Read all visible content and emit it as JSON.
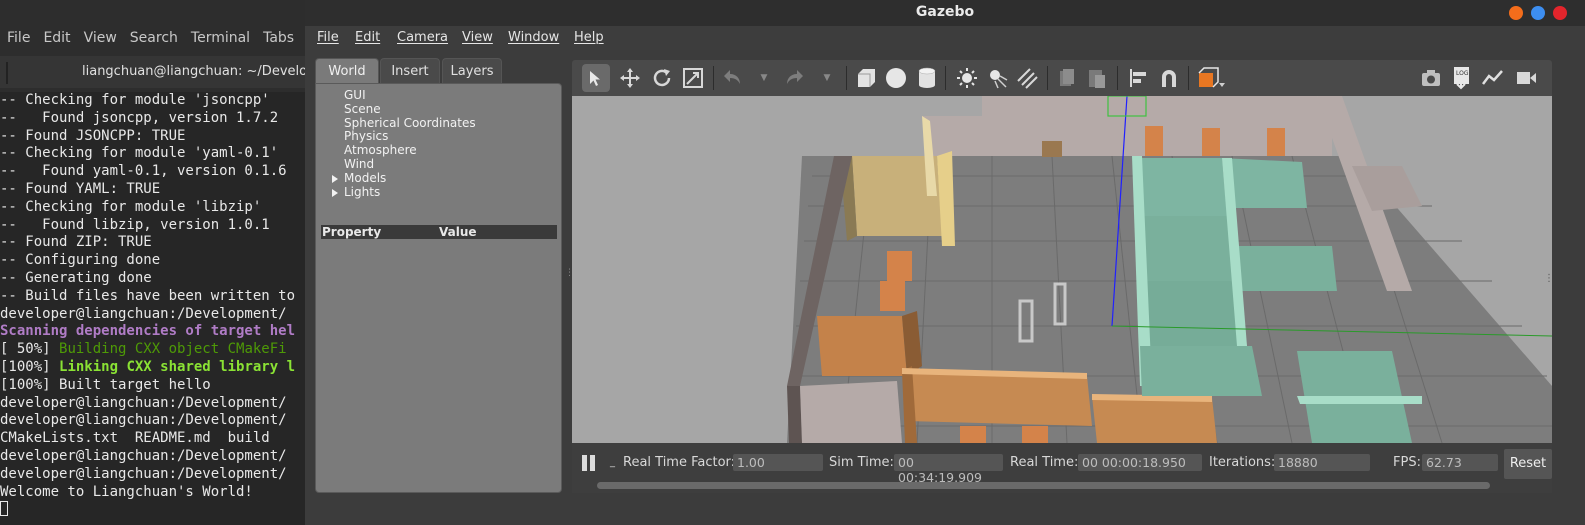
{
  "terminal": {
    "menu": [
      "File",
      "Edit",
      "View",
      "Search",
      "Terminal",
      "Tabs"
    ],
    "title": "liangchuan@liangchuan: ~/Develop",
    "lines": [
      {
        "text": "-- Checking for module 'jsoncpp'",
        "style": ""
      },
      {
        "text": "--   Found jsoncpp, version 1.7.2",
        "style": ""
      },
      {
        "text": "-- Found JSONCPP: TRUE",
        "style": ""
      },
      {
        "text": "-- Checking for module 'yaml-0.1'",
        "style": ""
      },
      {
        "text": "--   Found yaml-0.1, version 0.1.6",
        "style": ""
      },
      {
        "text": "-- Found YAML: TRUE",
        "style": ""
      },
      {
        "text": "-- Checking for module 'libzip'",
        "style": ""
      },
      {
        "text": "--   Found libzip, version 1.0.1",
        "style": ""
      },
      {
        "text": "-- Found ZIP: TRUE",
        "style": ""
      },
      {
        "text": "-- Configuring done",
        "style": ""
      },
      {
        "text": "-- Generating done",
        "style": ""
      },
      {
        "text": "-- Build files have been written to",
        "style": ""
      },
      {
        "text": "developer@liangchuan:/Development/",
        "style": ""
      },
      {
        "text": "Scanning dependencies of target hel",
        "style": "purple"
      },
      {
        "prefix": "[ 50%] ",
        "text": "Building CXX object CMakeFi",
        "style": "green"
      },
      {
        "prefix": "[100%] ",
        "text": "Linking CXX shared library l",
        "style": "bgreen"
      },
      {
        "text": "[100%] Built target hello",
        "style": ""
      },
      {
        "text": "developer@liangchuan:/Development/",
        "style": ""
      },
      {
        "text": "developer@liangchuan:/Development/",
        "style": ""
      },
      {
        "text": "CMakeLists.txt  README.md  build  ",
        "style": ""
      },
      {
        "text": "developer@liangchuan:/Development/",
        "style": ""
      },
      {
        "text": "developer@liangchuan:/Development/",
        "style": ""
      },
      {
        "text": "Welcome to Liangchuan's World!",
        "style": ""
      }
    ]
  },
  "gazebo": {
    "title": "Gazebo",
    "menu": [
      "File",
      "Edit",
      "Camera",
      "View",
      "Window",
      "Help"
    ],
    "tabs": [
      "World",
      "Insert",
      "Layers"
    ],
    "active_tab": "World",
    "world_tree": [
      {
        "label": "GUI",
        "expandable": false
      },
      {
        "label": "Scene",
        "expandable": false
      },
      {
        "label": "Spherical Coordinates",
        "expandable": false
      },
      {
        "label": "Physics",
        "expandable": false
      },
      {
        "label": "Atmosphere",
        "expandable": false
      },
      {
        "label": "Wind",
        "expandable": false
      },
      {
        "label": "Models",
        "expandable": true
      },
      {
        "label": "Lights",
        "expandable": true
      }
    ],
    "property_header": {
      "property": "Property",
      "value": "Value"
    },
    "toolbar_icons": [
      "select-arrow-icon",
      "translate-icon",
      "rotate-icon",
      "scale-icon",
      "undo-icon",
      "undo-dropdown-icon",
      "redo-icon",
      "redo-dropdown-icon",
      "box-shape-icon",
      "sphere-shape-icon",
      "cylinder-shape-icon",
      "point-light-icon",
      "spot-light-icon",
      "directional-light-icon",
      "copy-icon",
      "paste-icon",
      "align-icon",
      "snap-magnet-icon",
      "view-angle-icon",
      "screenshot-icon",
      "log-icon",
      "plot-icon",
      "video-record-icon"
    ],
    "status": {
      "real_time_factor_label": "Real Time Factor:",
      "real_time_factor": "1.00",
      "sim_time_label": "Sim Time:",
      "sim_time": "00 00:34:19.909",
      "real_time_label": "Real Time:",
      "real_time": "00 00:00:18.950",
      "iterations_label": "Iterations:",
      "iterations": "18880",
      "fps_label": "FPS:",
      "fps": "62.73",
      "reset_label": "Reset"
    },
    "window_button_colors": {
      "minimize": "#f46d1b",
      "maximize": "#3d8ef0",
      "close": "#e3252c"
    }
  }
}
